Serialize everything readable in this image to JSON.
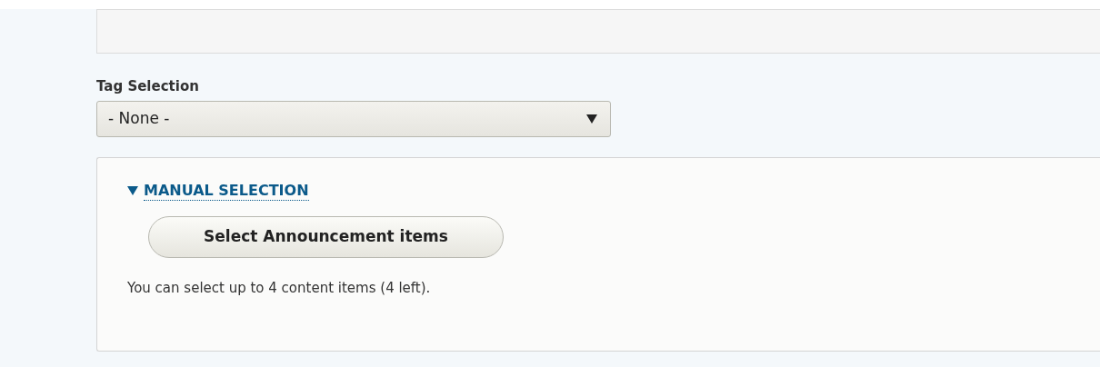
{
  "tag_selection": {
    "label": "Tag Selection",
    "value": "- None -"
  },
  "manual_selection": {
    "summary": "MANUAL SELECTION",
    "expanded": true,
    "button": "Select Announcement items",
    "description": "You can select up to 4 content items (4 left)."
  }
}
